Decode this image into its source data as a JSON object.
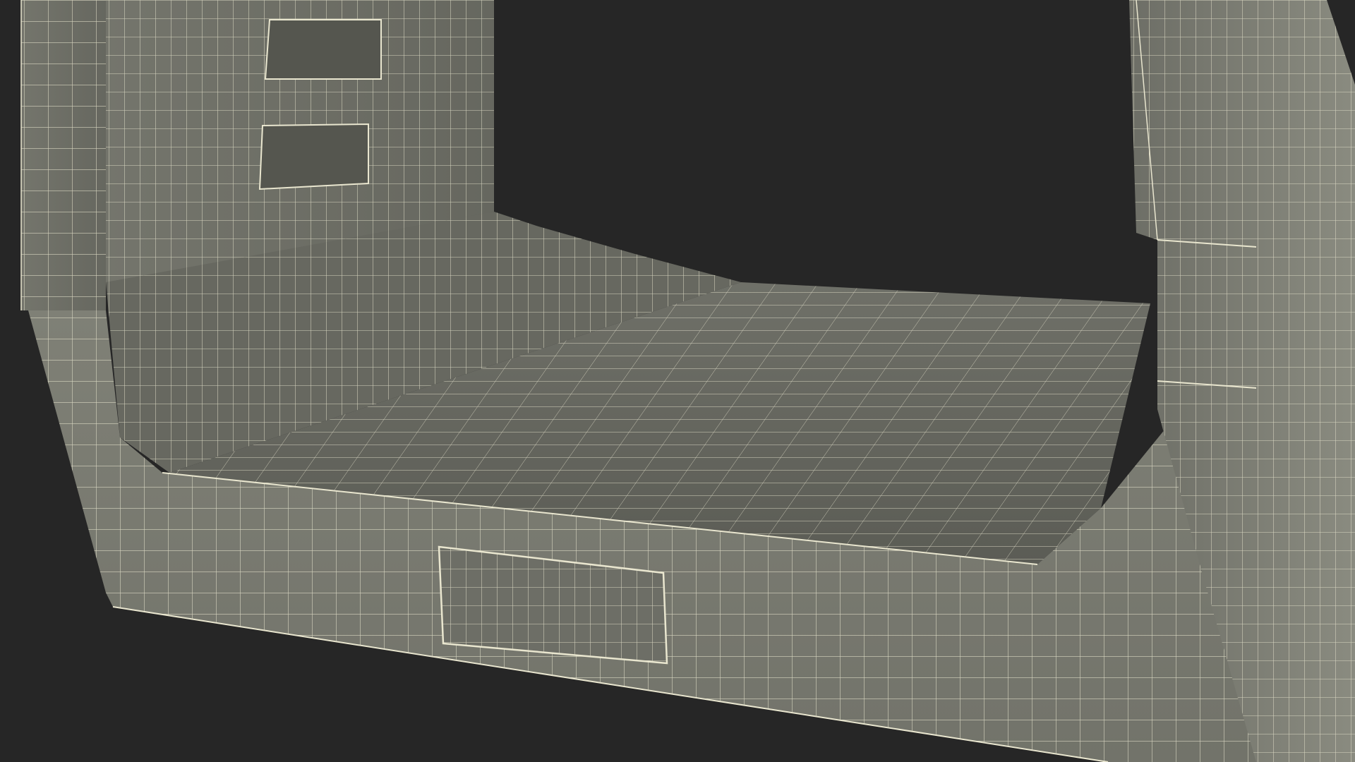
{
  "scene": {
    "background_color": "#262626",
    "surface_color": "#7a7b71",
    "surface_shadow_color": "#5e5f57",
    "surface_highlight_color": "#8a8b80",
    "wire_color": "#e9e6cf",
    "subject": "wireframe-3d-model"
  }
}
